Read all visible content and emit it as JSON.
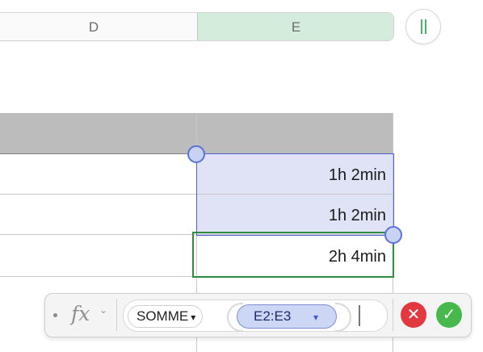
{
  "columns": {
    "d_label": "D",
    "e_label": "E"
  },
  "cells": {
    "e2": "1h 2min",
    "e3": "1h 2min",
    "e4": "2h 4min"
  },
  "formula_bar": {
    "function_name": "SOMME",
    "function_arrow": "▾",
    "range_ref": "E2:E3",
    "range_arrow": "▾",
    "fx_label": "fx",
    "chevron": "⌄",
    "cancel_glyph": "✕",
    "confirm_glyph": "✓"
  },
  "colors": {
    "selection_fill": "#dfe3f5",
    "selection_border": "#4a5fd0",
    "active_border": "#2e8c3e",
    "cancel": "#e2383f",
    "confirm": "#46b84c"
  }
}
